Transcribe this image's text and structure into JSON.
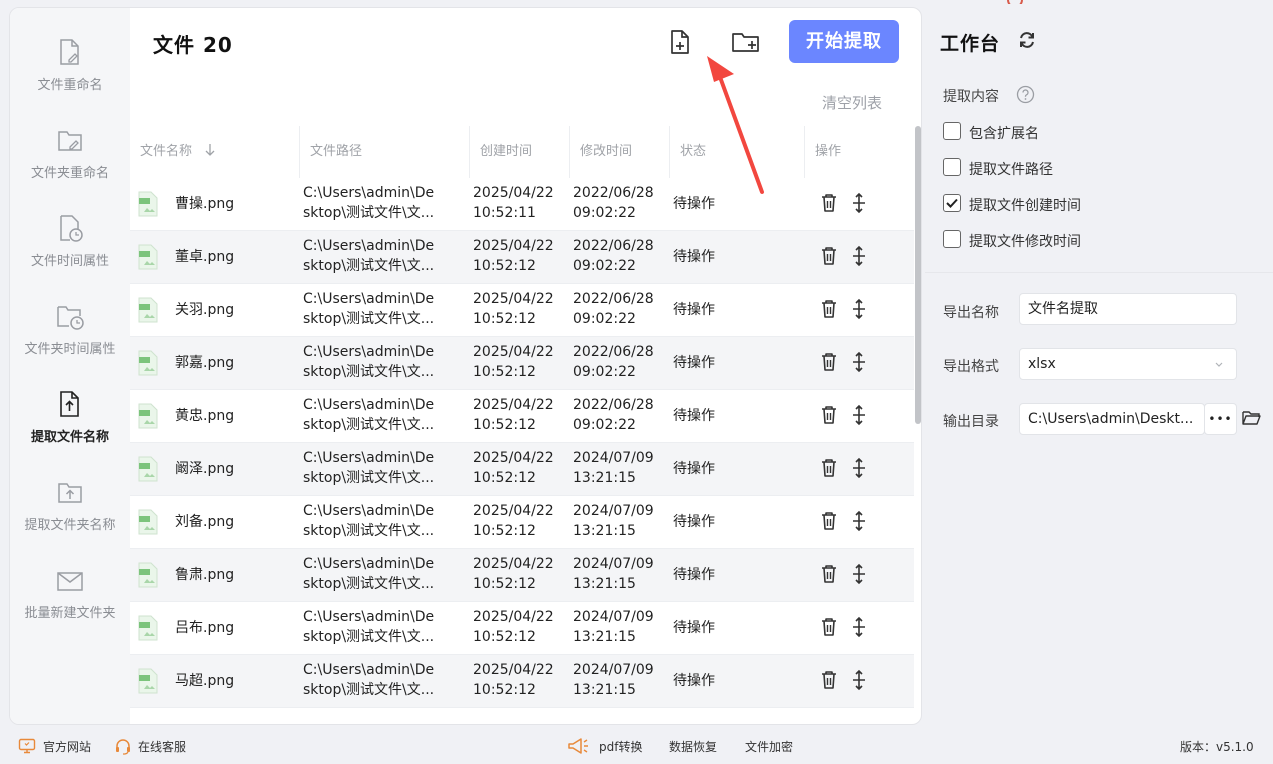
{
  "sidebar": {
    "items": [
      {
        "label": "文件重命名",
        "icon": "file-edit-icon"
      },
      {
        "label": "文件夹重命名",
        "icon": "folder-edit-icon"
      },
      {
        "label": "文件时间属性",
        "icon": "file-clock-icon"
      },
      {
        "label": "文件夹时间属性",
        "icon": "folder-clock-icon"
      },
      {
        "label": "提取文件名称",
        "icon": "file-upload-icon",
        "active": true
      },
      {
        "label": "提取文件夹名称",
        "icon": "folder-upload-icon"
      },
      {
        "label": "批量新建文件夹",
        "icon": "mail-folder-icon"
      }
    ]
  },
  "header": {
    "title": "文件 20",
    "start_label": "开始提取",
    "clear_label": "清空列表"
  },
  "table": {
    "columns": [
      "文件名称",
      "文件路径",
      "创建时间",
      "修改时间",
      "状态",
      "操作"
    ],
    "rows": [
      {
        "name": "曹操.png",
        "path1": "C:\\Users\\admin\\De",
        "path2": "sktop\\测试文件\\文...",
        "c1": "2025/04/22",
        "c2": "10:52:11",
        "m1": "2022/06/28",
        "m2": "09:02:22",
        "status": "待操作"
      },
      {
        "name": "董卓.png",
        "path1": "C:\\Users\\admin\\De",
        "path2": "sktop\\测试文件\\文...",
        "c1": "2025/04/22",
        "c2": "10:52:12",
        "m1": "2022/06/28",
        "m2": "09:02:22",
        "status": "待操作"
      },
      {
        "name": "关羽.png",
        "path1": "C:\\Users\\admin\\De",
        "path2": "sktop\\测试文件\\文...",
        "c1": "2025/04/22",
        "c2": "10:52:12",
        "m1": "2022/06/28",
        "m2": "09:02:22",
        "status": "待操作"
      },
      {
        "name": "郭嘉.png",
        "path1": "C:\\Users\\admin\\De",
        "path2": "sktop\\测试文件\\文...",
        "c1": "2025/04/22",
        "c2": "10:52:12",
        "m1": "2022/06/28",
        "m2": "09:02:22",
        "status": "待操作"
      },
      {
        "name": "黄忠.png",
        "path1": "C:\\Users\\admin\\De",
        "path2": "sktop\\测试文件\\文...",
        "c1": "2025/04/22",
        "c2": "10:52:12",
        "m1": "2022/06/28",
        "m2": "09:02:22",
        "status": "待操作"
      },
      {
        "name": "阚泽.png",
        "path1": "C:\\Users\\admin\\De",
        "path2": "sktop\\测试文件\\文...",
        "c1": "2025/04/22",
        "c2": "10:52:12",
        "m1": "2024/07/09",
        "m2": "13:21:15",
        "status": "待操作"
      },
      {
        "name": "刘备.png",
        "path1": "C:\\Users\\admin\\De",
        "path2": "sktop\\测试文件\\文...",
        "c1": "2025/04/22",
        "c2": "10:52:12",
        "m1": "2024/07/09",
        "m2": "13:21:15",
        "status": "待操作"
      },
      {
        "name": "鲁肃.png",
        "path1": "C:\\Users\\admin\\De",
        "path2": "sktop\\测试文件\\文...",
        "c1": "2025/04/22",
        "c2": "10:52:12",
        "m1": "2024/07/09",
        "m2": "13:21:15",
        "status": "待操作"
      },
      {
        "name": "吕布.png",
        "path1": "C:\\Users\\admin\\De",
        "path2": "sktop\\测试文件\\文...",
        "c1": "2025/04/22",
        "c2": "10:52:12",
        "m1": "2024/07/09",
        "m2": "13:21:15",
        "status": "待操作"
      },
      {
        "name": "马超.png",
        "path1": "C:\\Users\\admin\\De",
        "path2": "sktop\\测试文件\\文...",
        "c1": "2025/04/22",
        "c2": "10:52:12",
        "m1": "2024/07/09",
        "m2": "13:21:15",
        "status": "待操作"
      }
    ]
  },
  "panel": {
    "title": "工作台",
    "content_label": "提取内容",
    "options": [
      {
        "label": "包含扩展名",
        "checked": false
      },
      {
        "label": "提取文件路径",
        "checked": false
      },
      {
        "label": "提取文件创建时间",
        "checked": true
      },
      {
        "label": "提取文件修改时间",
        "checked": false
      }
    ],
    "export_name_label": "导出名称",
    "export_name_value": "文件名提取",
    "export_format_label": "导出格式",
    "export_format_value": "xlsx",
    "output_dir_label": "输出目录",
    "output_dir_value": "C:\\Users\\admin\\Deskt...",
    "browse_label": "•••"
  },
  "footer": {
    "website": "官方网站",
    "service": "在线客服",
    "pdf": "pdf转换",
    "recovery": "数据恢复",
    "encrypt": "文件加密",
    "version": "版本：v5.1.0"
  },
  "colors": {
    "accent": "#6b86ff",
    "arrow": "#f2473f"
  }
}
